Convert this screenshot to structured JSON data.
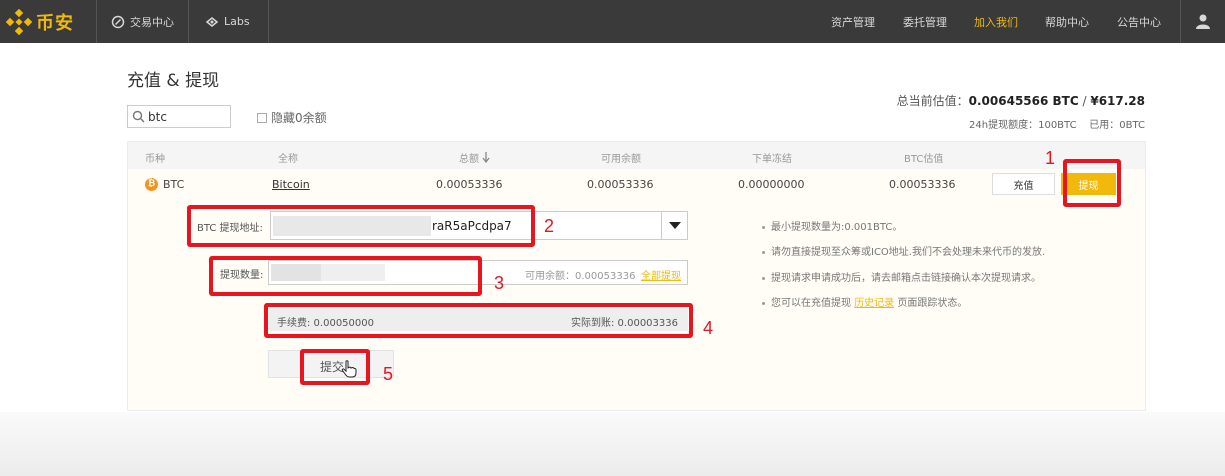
{
  "nav": {
    "logo_text": "币安",
    "items": [
      {
        "label": "交易中心",
        "icon": "exchange-icon"
      },
      {
        "label": "Labs",
        "icon": "labs-icon"
      }
    ],
    "right": [
      "资产管理",
      "委托管理",
      "加入我们",
      "帮助中心",
      "公告中心"
    ],
    "active_right": "加入我们",
    "user_icon": "user-icon"
  },
  "page": {
    "title": "充值 & 提现",
    "search_value": "btc",
    "hide_zero_label": "隐藏0余额",
    "estimate_label": "总当前估值：",
    "estimate_btc": "0.00645566 BTC",
    "estimate_sep": " / ",
    "estimate_cny": "¥617.28",
    "quota_label": "24h提现额度：100BTC",
    "quota_used": "已用：0BTC"
  },
  "table": {
    "headers": [
      "币种",
      "全称",
      "总额",
      "可用余额",
      "下单冻结",
      "BTC估值"
    ],
    "sort_icon": "arrow-down-icon",
    "row": {
      "coin": "BTC",
      "coin_icon": "bitcoin-icon",
      "name": "Bitcoin",
      "total": "0.00053336",
      "available": "0.00053336",
      "frozen": "0.00000000",
      "btc_value": "0.00053336",
      "deposit": "充值",
      "withdraw": "提现"
    }
  },
  "form": {
    "address_label": "BTC 提现地址:",
    "address_value": "raR5aPcdpa7",
    "amount_label": "提现数量:",
    "available_label": "可用余额：0.00053336",
    "withdraw_all": "全部提现",
    "fee_label": "手续费: 0.00050000",
    "received_label": "实际到账: 0.00003336",
    "submit": "提交"
  },
  "tips": [
    {
      "text": "最小提现数量为:0.001BTC。"
    },
    {
      "text": "请勿直接提现至众筹或ICO地址.我们不会处理未来代币的发放."
    },
    {
      "text": "提现请求申请成功后，请去邮箱点击链接确认本次提现请求。"
    },
    {
      "pre": "您可以在充值提现 ",
      "link": "历史记录",
      "post": " 页面跟踪状态。"
    }
  ],
  "annotations": [
    "1",
    "2",
    "3",
    "4",
    "5"
  ],
  "colors": {
    "accent": "#f0b90b",
    "annotation": "#e8141f",
    "nav_bg": "#3a3a3a"
  }
}
